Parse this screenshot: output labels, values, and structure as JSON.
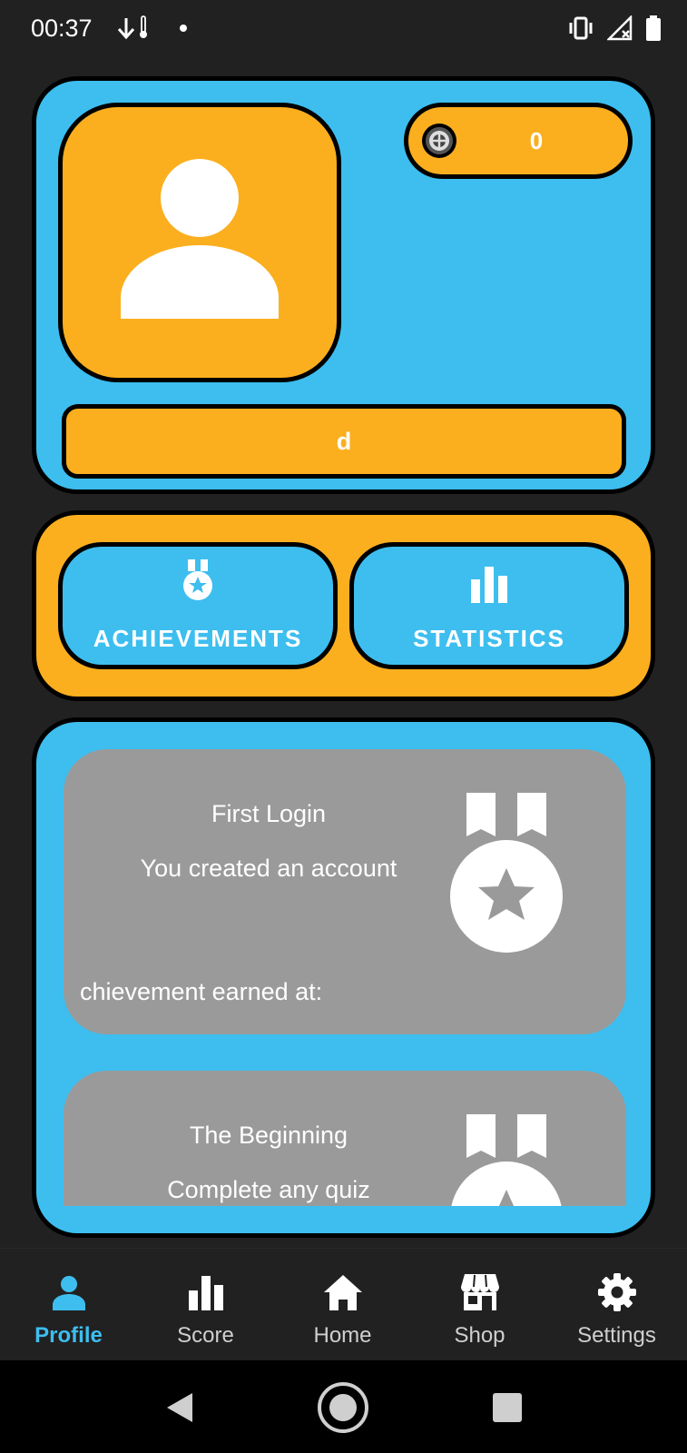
{
  "status_bar": {
    "time": "00:37",
    "left_icons": [
      "download-arrow-icon",
      "thermometer-icon",
      "notification-dot-icon"
    ],
    "right_icons": [
      "vibrate-icon",
      "no-signal-icon",
      "battery-icon"
    ]
  },
  "profile": {
    "coins": "0",
    "username": "d"
  },
  "tabs": [
    {
      "label": "ACHIEVEMENTS",
      "icon": "medal-icon"
    },
    {
      "label": "STATISTICS",
      "icon": "bar-chart-icon"
    }
  ],
  "achievements": [
    {
      "title": "First Login",
      "description": "You created an account",
      "earned_label": "chievement earned at:"
    },
    {
      "title": "The Beginning",
      "description": "Complete any quiz"
    }
  ],
  "bottom_nav": [
    {
      "label": "Profile",
      "icon": "person-icon",
      "active": true
    },
    {
      "label": "Score",
      "icon": "bar-chart-icon",
      "active": false
    },
    {
      "label": "Home",
      "icon": "home-icon",
      "active": false
    },
    {
      "label": "Shop",
      "icon": "store-icon",
      "active": false
    },
    {
      "label": "Settings",
      "icon": "gear-icon",
      "active": false
    }
  ],
  "colors": {
    "background": "#212121",
    "blue": "#3DBEEF",
    "orange": "#FBAF1E",
    "card_gray": "#9A9A9A",
    "border": "#000000"
  }
}
